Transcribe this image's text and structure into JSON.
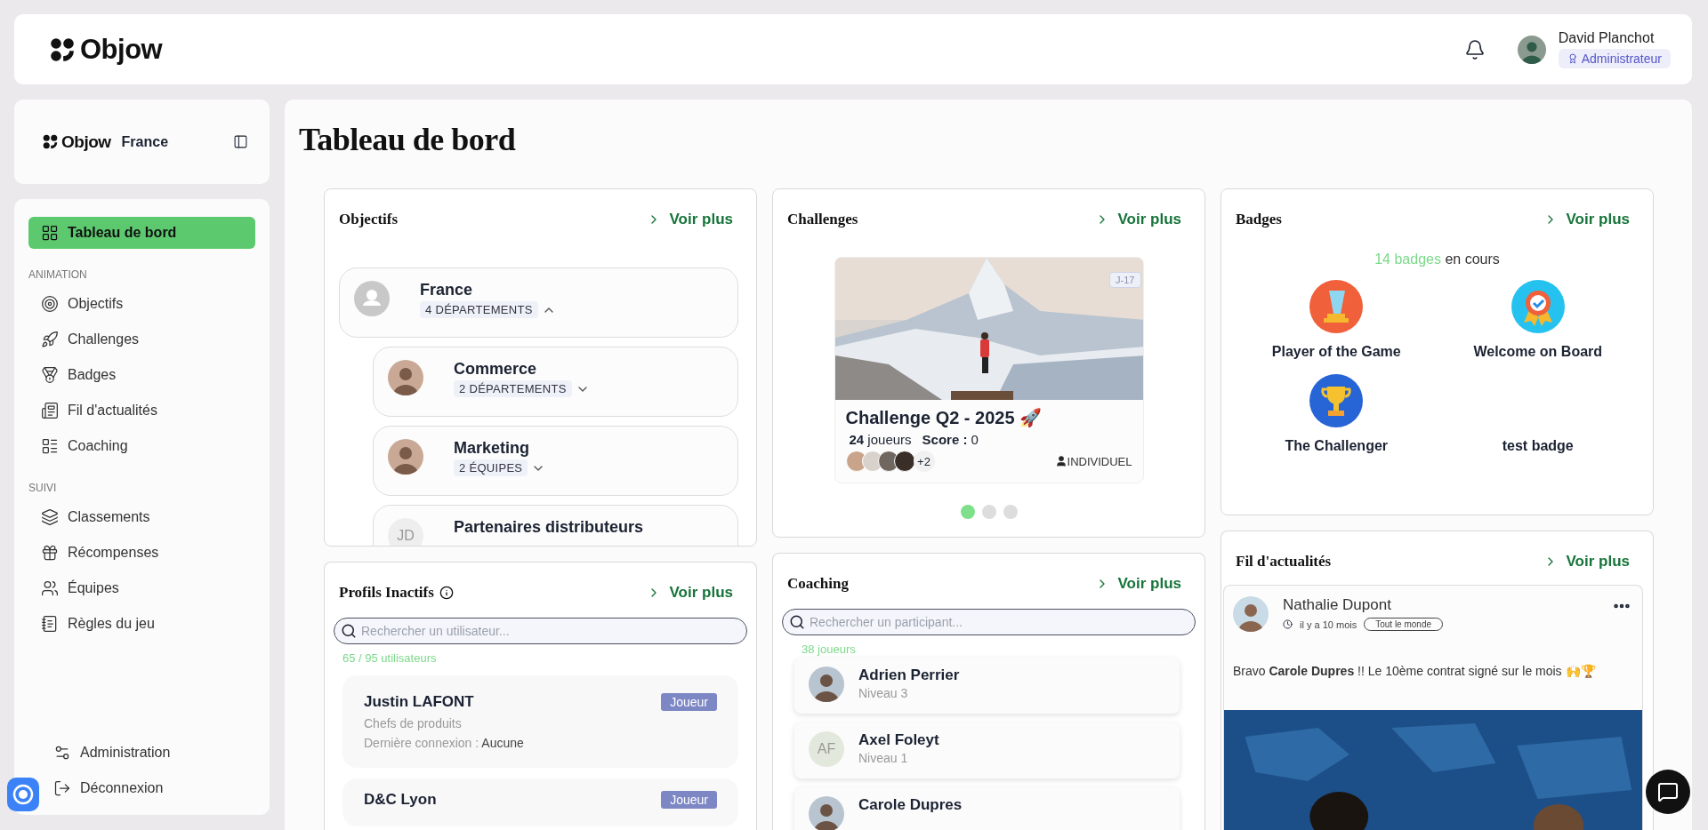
{
  "header": {
    "logo": "Objow",
    "user": {
      "name": "David Planchot",
      "role": "Administrateur"
    }
  },
  "sidebar": {
    "brand": "Objow",
    "org": "France",
    "primary": [
      {
        "label": "Tableau de bord",
        "selected": true
      }
    ],
    "sections": [
      {
        "title": "ANIMATION",
        "items": [
          {
            "label": "Objectifs",
            "selected": false
          },
          {
            "label": "Challenges",
            "selected": false
          },
          {
            "label": "Badges",
            "selected": false
          },
          {
            "label": "Fil d'actualités",
            "selected": false
          },
          {
            "label": "Coaching",
            "selected": false
          }
        ]
      },
      {
        "title": "SUIVI",
        "items": [
          {
            "label": "Classements",
            "selected": false
          },
          {
            "label": "Récompenses",
            "selected": false
          },
          {
            "label": "Équipes",
            "selected": false
          },
          {
            "label": "Règles du jeu",
            "selected": false
          }
        ]
      }
    ],
    "footer": [
      {
        "label": "Administration",
        "selected": false
      },
      {
        "label": "Déconnexion",
        "selected": false
      }
    ]
  },
  "page_title": "Tableau de bord",
  "objectives": {
    "title": "Objectifs",
    "more": "Voir plus",
    "tree": [
      {
        "name": "France",
        "avatar": {
          "kind": "placeholder"
        },
        "tag": "4 DÉPARTEMENTS",
        "expanded": true,
        "children": [
          {
            "name": "Commerce",
            "tag": "2 DÉPARTEMENTS",
            "expanded": false
          },
          {
            "name": "Marketing",
            "tag": "2 ÉQUIPES",
            "expanded": false
          },
          {
            "name": "Partenaires distributeurs",
            "avatar": {
              "kind": "initials",
              "initials": "JD"
            }
          }
        ]
      }
    ]
  },
  "inactive_profiles": {
    "title": "Profils Inactifs",
    "more": "Voir plus",
    "search": {
      "placeholder": "Rechercher un utilisateur..."
    },
    "count": "65 / 95 utilisateurs",
    "profiles": [
      {
        "name": "Justin LAFONT",
        "team": "Chefs de produits",
        "login_label": "Dernière connexion :",
        "login": "Aucune",
        "role": "Joueur"
      },
      {
        "name": "D&C Lyon",
        "role": "Joueur"
      }
    ]
  },
  "challenges": {
    "title": "Challenges",
    "more": "Voir plus",
    "card": {
      "countdown": "J-17",
      "name": "Challenge Q2 - 2025 🚀",
      "players": "24",
      "players_label": "joueurs",
      "score_label": "Score :",
      "score": "0",
      "extra": "+2",
      "mode": "INDIVIDUEL"
    },
    "dots": [
      {
        "selected": true
      },
      {
        "selected": false
      },
      {
        "selected": false
      }
    ]
  },
  "coaching": {
    "title": "Coaching",
    "more": "Voir plus",
    "search": {
      "placeholder": "Rechercher un participant..."
    },
    "count": "38 joueurs",
    "participants": [
      {
        "name": "Adrien Perrier",
        "level": "Niveau 3"
      },
      {
        "name": "Axel Foleyt",
        "level": "Niveau 1",
        "avatar": {
          "kind": "initials",
          "initials": "AF"
        }
      },
      {
        "name": "Carole Dupres"
      }
    ]
  },
  "badges": {
    "title": "Badges",
    "more": "Voir plus",
    "count": "14 badges",
    "count_suffix": "en cours",
    "items": [
      {
        "name": "Player of the Game",
        "kind": "podium"
      },
      {
        "name": "Welcome on Board",
        "kind": "medal"
      },
      {
        "name": "The Challenger",
        "kind": "trophy"
      },
      {
        "name": "test badge",
        "kind": "blank"
      }
    ]
  },
  "news": {
    "title": "Fil d'actualités",
    "more": "Voir plus",
    "post": {
      "author": "Nathalie Dupont",
      "time": "il y a 10 mois",
      "audience": "Tout le monde",
      "text": "Bravo **Carole Dupres** !! Le 10ème contrat signé sur le mois 🙌🏆"
    }
  }
}
